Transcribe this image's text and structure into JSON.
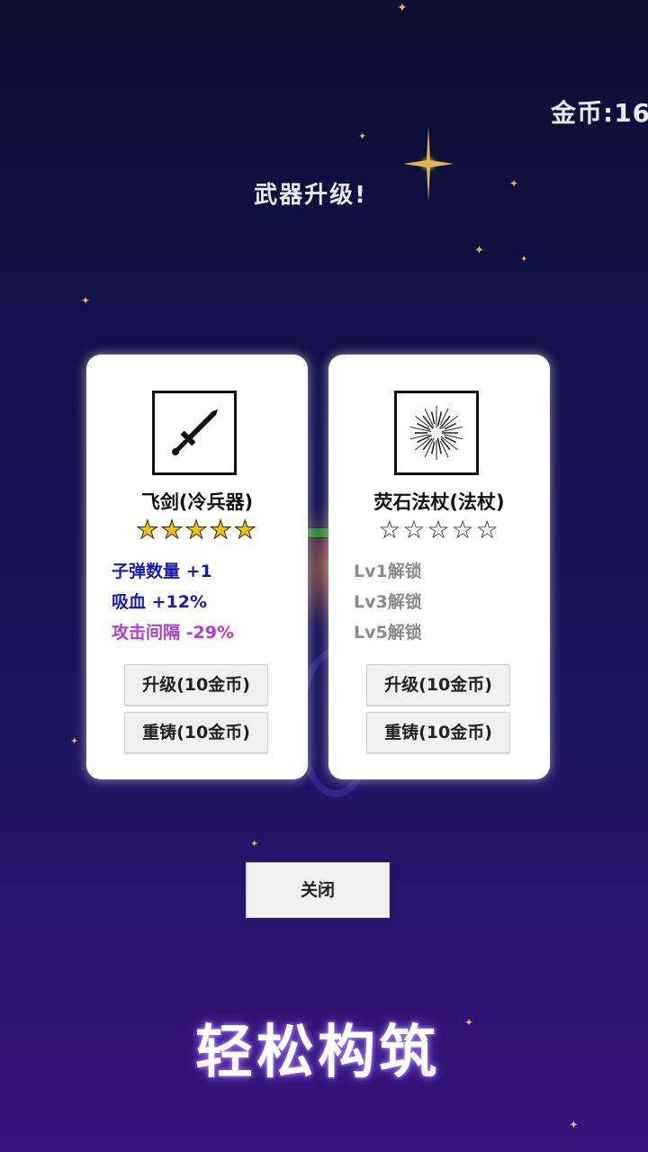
{
  "hud": {
    "coins_text": "金币:16"
  },
  "dialog": {
    "title": "武器升级!"
  },
  "cards": [
    {
      "icon": "sword-icon",
      "name": "飞剑(冷兵器)",
      "stars_filled": 5,
      "stars_total": 5,
      "stats": [
        {
          "text": "子弹数量 +1",
          "color": "#1a1ab4"
        },
        {
          "text": "吸血 +12%",
          "color": "#1a1ab4"
        },
        {
          "text": "攻击间隔 -29%",
          "color": "#b43ad4"
        }
      ],
      "upgrade_label": "升级(10金币)",
      "reforge_label": "重铸(10金币)"
    },
    {
      "icon": "starburst-icon",
      "name": "荧石法杖(法杖)",
      "stars_filled": 0,
      "stars_total": 5,
      "stats": [
        {
          "text": "Lv1解锁",
          "color": "#8a8a8a"
        },
        {
          "text": "Lv3解锁",
          "color": "#8a8a8a"
        },
        {
          "text": "Lv5解锁",
          "color": "#8a8a8a"
        }
      ],
      "upgrade_label": "升级(10金币)",
      "reforge_label": "重铸(10金币)"
    }
  ],
  "close_label": "关闭",
  "slogan": "轻松构筑",
  "colors": {
    "card_bg": "#ffffff",
    "star_gold": "#f2c200",
    "bg_top": "#0b0f30",
    "bg_bottom": "#34157a"
  }
}
